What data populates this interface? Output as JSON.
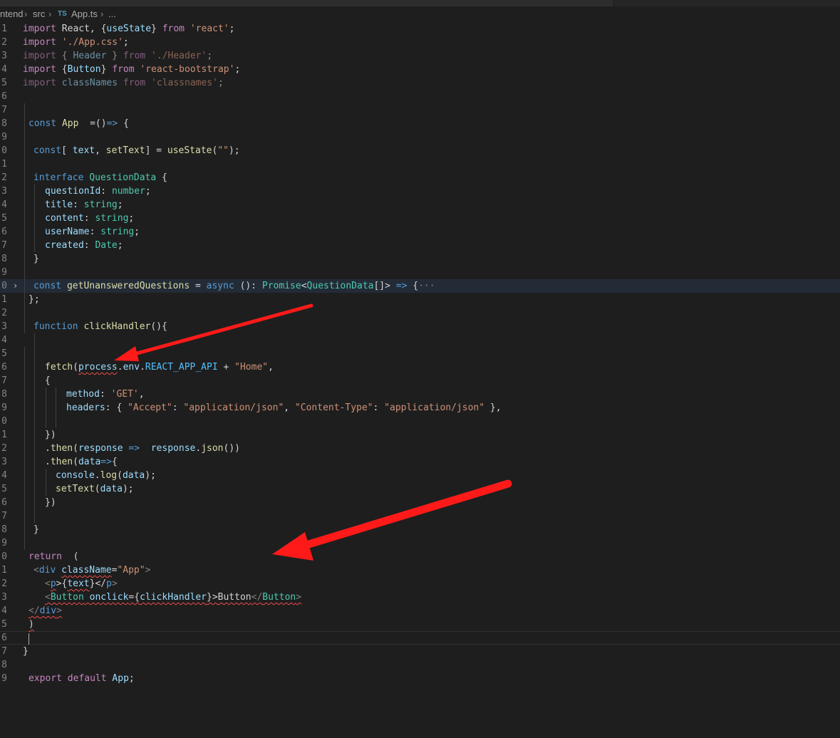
{
  "breadcrumb": {
    "folder": "ntend",
    "src": "src",
    "file_badge": "TS",
    "file": "App.ts",
    "more": "..."
  },
  "editor": {
    "line_numbers": [
      "1",
      "2",
      "3",
      "4",
      "5",
      "6",
      "7",
      "8",
      "9",
      "0",
      "1",
      "2",
      "3",
      "4",
      "5",
      "6",
      "7",
      "8",
      "9",
      "0",
      "1",
      "2",
      "3",
      "4",
      "5",
      "6",
      "7",
      "8",
      "9",
      "0",
      "1",
      "2",
      "3",
      "4",
      "5",
      "6",
      "7",
      "8",
      "9",
      "0",
      "1",
      "2",
      "3",
      "4",
      "5",
      "6",
      "7",
      "8",
      "9"
    ],
    "lines": {
      "l1": [
        "import",
        " React, {",
        "useState",
        "} ",
        "from",
        " ",
        "'react'",
        ";"
      ],
      "l2": [
        "import",
        " ",
        "'./App.css'",
        ";"
      ],
      "l3": [
        "import",
        " { ",
        "Header",
        " } ",
        "from",
        " ",
        "'./Header'",
        ";"
      ],
      "l4": [
        "import",
        " {",
        "Button",
        "} ",
        "from",
        " ",
        "'react-bootstrap'",
        ";"
      ],
      "l5": [
        "import",
        " ",
        "classNames",
        " ",
        "from",
        " ",
        "'classnames'",
        ";"
      ],
      "l8": [
        "const",
        " ",
        "App",
        "  =()",
        "=>",
        " {"
      ],
      "l10": [
        "const",
        "[ ",
        "text",
        ", ",
        "setText",
        "] = ",
        "useState",
        "(",
        "\"\"",
        ");"
      ],
      "l12": [
        "interface",
        " ",
        "QuestionData",
        " {"
      ],
      "l13": [
        "questionId",
        ": ",
        "number",
        ";"
      ],
      "l14": [
        "title",
        ": ",
        "string",
        ";"
      ],
      "l15": [
        "content",
        ": ",
        "string",
        ";"
      ],
      "l16": [
        "userName",
        ": ",
        "string",
        ";"
      ],
      "l17": [
        "created",
        ": ",
        "Date",
        ";"
      ],
      "l18": [
        "}"
      ],
      "l20": [
        "const",
        " ",
        "getUnansweredQuestions",
        " = ",
        "async",
        " (): ",
        "Promise",
        "<",
        "QuestionData",
        "[]> ",
        "=>",
        " {",
        "···"
      ],
      "l21": [
        "};"
      ],
      "l23": [
        "function",
        " ",
        "clickHandler",
        "(){"
      ],
      "l26": [
        "fetch",
        "(",
        "process",
        ".",
        "env",
        ".",
        "REACT_APP_API",
        " + ",
        "\"Home\"",
        ","
      ],
      "l27": [
        "{"
      ],
      "l28": [
        "method",
        ": ",
        "'GET'",
        ","
      ],
      "l29": [
        "headers",
        ": { ",
        "\"Accept\"",
        ": ",
        "\"application/json\"",
        ", ",
        "\"Content-Type\"",
        ": ",
        "\"application/json\"",
        " },"
      ],
      "l31": [
        "})"
      ],
      "l32": [
        ".",
        "then",
        "(",
        "response",
        " ",
        "=>",
        "  ",
        "response",
        ".",
        "json",
        "())"
      ],
      "l33": [
        ".",
        "then",
        "(",
        "data",
        "=>",
        "{"
      ],
      "l34": [
        "console",
        ".",
        "log",
        "(",
        "data",
        ");"
      ],
      "l35": [
        "setText",
        "(",
        "data",
        ");"
      ],
      "l36": [
        "})"
      ],
      "l38": [
        "}"
      ],
      "l40": [
        "return",
        "  ("
      ],
      "l41": [
        "<",
        "div",
        " ",
        "className",
        "=",
        "\"App\"",
        ">"
      ],
      "l42": [
        "<",
        "p",
        ">{",
        "text",
        "}</",
        "p",
        ">"
      ],
      "l43": [
        "<",
        "Button",
        " ",
        "onclick",
        "={",
        "clickHandler",
        "}>",
        "Button",
        "</",
        "Button",
        ">"
      ],
      "l44": [
        "</",
        "div",
        ">"
      ],
      "l45": [
        ")"
      ],
      "l47": [
        "}"
      ],
      "l49": [
        "export",
        " ",
        "default",
        " ",
        "App",
        ";"
      ]
    }
  },
  "colors": {
    "background": "#1e1e1e",
    "arrow": "#ff1a1a",
    "keyword": "#569cd6",
    "control": "#c586c0",
    "string": "#ce9178",
    "type": "#4ec9b0"
  }
}
